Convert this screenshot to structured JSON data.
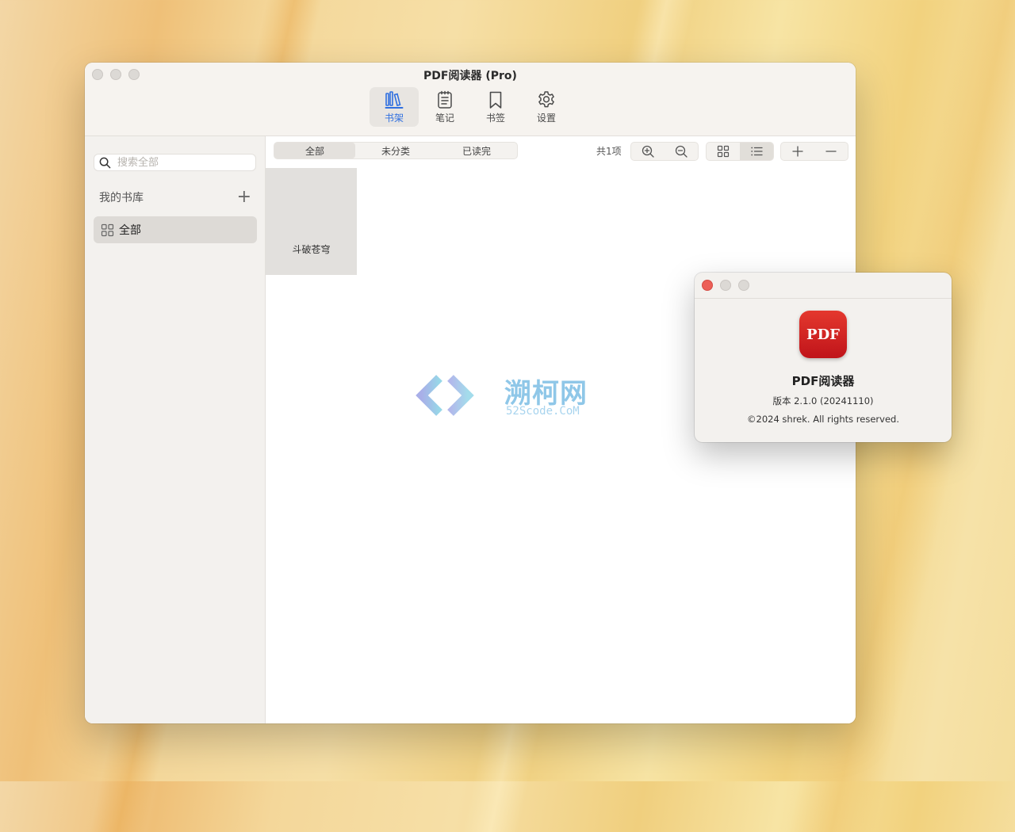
{
  "window": {
    "title": "PDF阅读器 (Pro)",
    "toolbar": [
      {
        "label": "书架",
        "icon": "bookshelf-icon",
        "active": true
      },
      {
        "label": "笔记",
        "icon": "notes-icon",
        "active": false
      },
      {
        "label": "书签",
        "icon": "bookmark-icon",
        "active": false
      },
      {
        "label": "设置",
        "icon": "gear-icon",
        "active": false
      }
    ]
  },
  "sidebar": {
    "search_placeholder": "搜索全部",
    "library_title": "我的书库",
    "add_label": "+",
    "items": [
      {
        "label": "全部",
        "icon": "grid-icon",
        "selected": true
      }
    ]
  },
  "content": {
    "filters": [
      {
        "label": "全部",
        "active": true
      },
      {
        "label": "未分类",
        "active": false
      },
      {
        "label": "已读完",
        "active": false
      }
    ],
    "count": "共1项",
    "books": [
      {
        "title": "斗破苍穹"
      }
    ],
    "watermark": {
      "text": "溯柯网",
      "sub": "52Scode.CoM"
    }
  },
  "about": {
    "icon_text": "PDF",
    "app_name": "PDF阅读器",
    "version": "版本 2.1.0 (20241110)",
    "copyright": "©2024 shrek. All rights reserved."
  },
  "colors": {
    "accent": "#2f6fe0",
    "close_red": "#ec5f57",
    "pdf_red": "#d0231f"
  }
}
